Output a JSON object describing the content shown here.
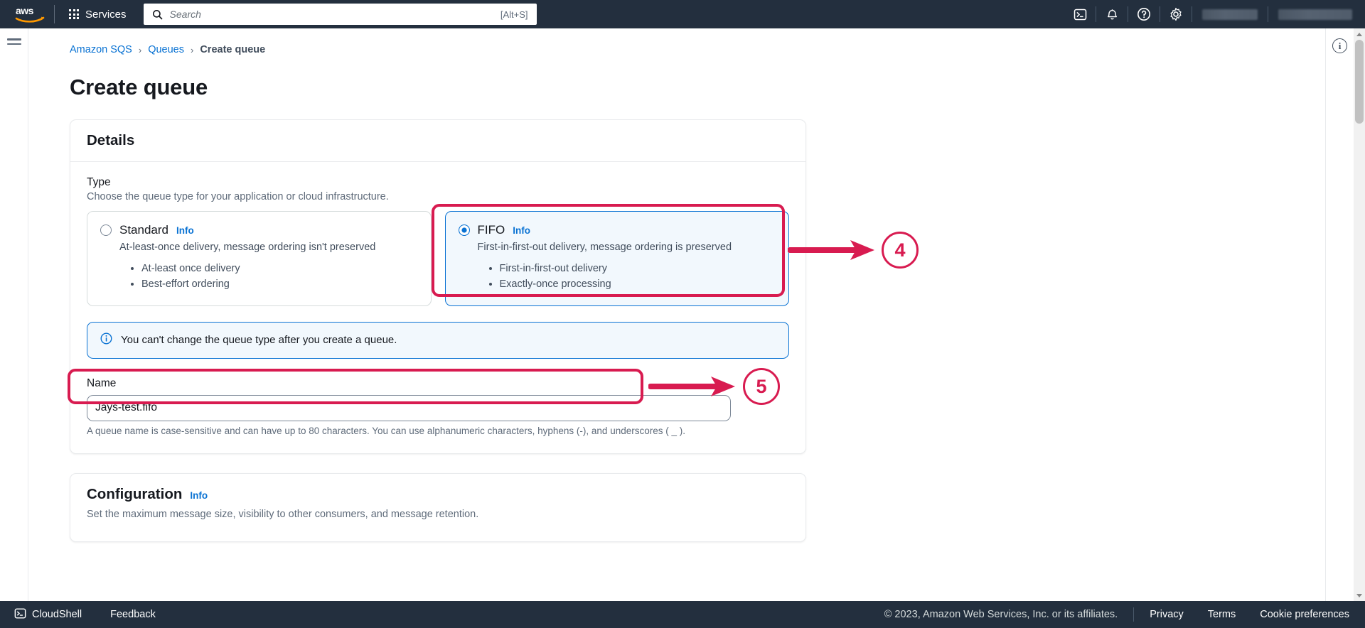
{
  "topnav": {
    "logo_alt": "aws",
    "services_label": "Services",
    "search_placeholder": "Search",
    "search_value": "",
    "search_shortcut": "[Alt+S]",
    "icons": {
      "cloudshell": "cloudshell-icon",
      "notifications": "bell-icon",
      "help": "help-circle-icon",
      "settings": "gear-icon"
    },
    "region_redacted": "",
    "account_redacted": ""
  },
  "breadcrumb": {
    "items": [
      {
        "label": "Amazon SQS",
        "link": true
      },
      {
        "label": "Queues",
        "link": true
      },
      {
        "label": "Create queue",
        "link": false
      }
    ],
    "separator": "›"
  },
  "page": {
    "title": "Create queue"
  },
  "details_card": {
    "header": "Details",
    "type": {
      "label": "Type",
      "description": "Choose the queue type for your application or cloud infrastructure.",
      "options": [
        {
          "id": "standard",
          "title": "Standard",
          "info_label": "Info",
          "subtitle": "At-least-once delivery, message ordering isn't preserved",
          "bullets": [
            "At-least once delivery",
            "Best-effort ordering"
          ],
          "selected": false
        },
        {
          "id": "fifo",
          "title": "FIFO",
          "info_label": "Info",
          "subtitle": "First-in-first-out delivery, message ordering is preserved",
          "bullets": [
            "First-in-first-out delivery",
            "Exactly-once processing"
          ],
          "selected": true
        }
      ]
    },
    "alert": {
      "icon": "info-circle-icon",
      "text": "You can't change the queue type after you create a queue."
    },
    "name": {
      "label": "Name",
      "value": "Jays-test.fifo",
      "placeholder": "",
      "hint": "A queue name is case-sensitive and can have up to 80 characters. You can use alphanumeric characters, hyphens (-), and underscores ( _ )."
    }
  },
  "configuration_card": {
    "header": "Configuration",
    "info_label": "Info",
    "description": "Set the maximum message size, visibility to other consumers, and message retention."
  },
  "info_panel": {
    "toggle_icon": "info-circle-icon",
    "toggle_glyph": "i"
  },
  "annotations": [
    {
      "number": "4",
      "target": "fifo-type-card"
    },
    {
      "number": "5",
      "target": "queue-name-input"
    }
  ],
  "footer": {
    "cloudshell_label": "CloudShell",
    "feedback_label": "Feedback",
    "copyright": "© 2023, Amazon Web Services, Inc. or its affiliates.",
    "links": [
      "Privacy",
      "Terms",
      "Cookie preferences"
    ]
  },
  "colors": {
    "nav_bg": "#232f3e",
    "link_blue": "#0972d3",
    "annotation_red": "#d81b50",
    "selected_bg": "#f2f8fd"
  }
}
